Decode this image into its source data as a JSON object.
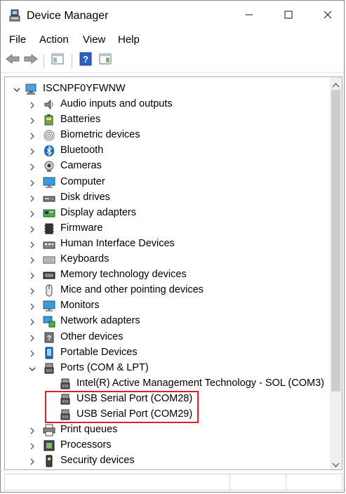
{
  "window": {
    "title": "Device Manager"
  },
  "menu": [
    {
      "label": "File"
    },
    {
      "label": "Action"
    },
    {
      "label": "View"
    },
    {
      "label": "Help"
    }
  ],
  "tree": {
    "root": "ISCNPF0YFWNW",
    "items": [
      {
        "label": "Audio inputs and outputs",
        "icon": "speaker-icon",
        "expanded": false
      },
      {
        "label": "Batteries",
        "icon": "battery-icon",
        "expanded": false
      },
      {
        "label": "Biometric devices",
        "icon": "fingerprint-icon",
        "expanded": false
      },
      {
        "label": "Bluetooth",
        "icon": "bluetooth-icon",
        "expanded": false
      },
      {
        "label": "Cameras",
        "icon": "camera-icon",
        "expanded": false
      },
      {
        "label": "Computer",
        "icon": "monitor-icon",
        "expanded": false
      },
      {
        "label": "Disk drives",
        "icon": "disk-icon",
        "expanded": false
      },
      {
        "label": "Display adapters",
        "icon": "display-adapter-icon",
        "expanded": false
      },
      {
        "label": "Firmware",
        "icon": "chip-icon",
        "expanded": false
      },
      {
        "label": "Human Interface Devices",
        "icon": "hid-icon",
        "expanded": false
      },
      {
        "label": "Keyboards",
        "icon": "keyboard-icon",
        "expanded": false
      },
      {
        "label": "Memory technology devices",
        "icon": "memory-icon",
        "expanded": false
      },
      {
        "label": "Mice and other pointing devices",
        "icon": "mouse-icon",
        "expanded": false
      },
      {
        "label": "Monitors",
        "icon": "monitor-icon",
        "expanded": false
      },
      {
        "label": "Network adapters",
        "icon": "network-icon",
        "expanded": false
      },
      {
        "label": "Other devices",
        "icon": "unknown-device-icon",
        "expanded": false
      },
      {
        "label": "Portable Devices",
        "icon": "portable-device-icon",
        "expanded": false
      },
      {
        "label": "Ports (COM & LPT)",
        "icon": "port-icon",
        "expanded": true,
        "children": [
          {
            "label": "Intel(R) Active Management Technology - SOL (COM3)",
            "icon": "port-icon"
          },
          {
            "label": "USB Serial Port (COM28)",
            "icon": "port-icon"
          },
          {
            "label": "USB Serial Port (COM29)",
            "icon": "port-icon"
          }
        ]
      },
      {
        "label": "Print queues",
        "icon": "printer-icon",
        "expanded": false
      },
      {
        "label": "Processors",
        "icon": "processor-icon",
        "expanded": false
      },
      {
        "label": "Security devices",
        "icon": "security-key-icon",
        "expanded": false
      }
    ]
  },
  "colors": {
    "highlight_border": "#d9222a",
    "accent_blue": "#1b6ec2"
  }
}
